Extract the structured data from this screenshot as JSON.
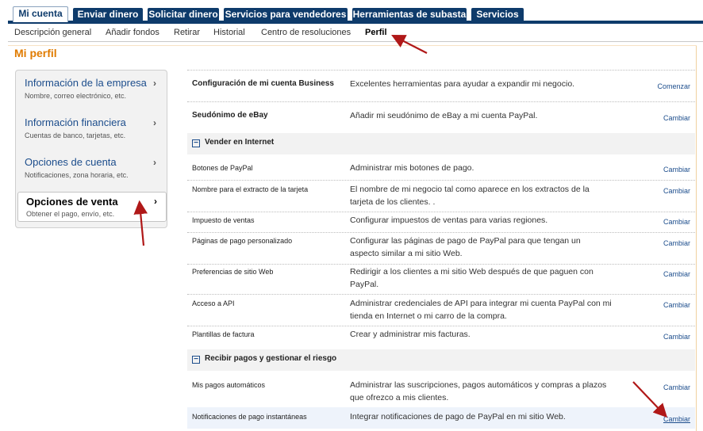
{
  "tabs": [
    {
      "label": "Mi cuenta",
      "active": true
    },
    {
      "label": "Enviar dinero"
    },
    {
      "label": "Solicitar dinero"
    },
    {
      "label": "Servicios para vendedores"
    },
    {
      "label": "Herramientas de subasta"
    },
    {
      "label": "Servicios"
    }
  ],
  "subnav": [
    {
      "label": "Descripción general"
    },
    {
      "label": "Añadir fondos"
    },
    {
      "label": "Retirar"
    },
    {
      "label": "Historial"
    },
    {
      "label": "Centro de resoluciones"
    },
    {
      "label": "Perfil",
      "active": true
    }
  ],
  "page_title": "Mi perfil",
  "sidebar": {
    "chevron": "›",
    "items": [
      {
        "title": "Información de la empresa",
        "subtitle": "Nombre, correo electrónico, etc."
      },
      {
        "title": "Información financiera",
        "subtitle": "Cuentas de banco, tarjetas, etc."
      },
      {
        "title": "Opciones de cuenta",
        "subtitle": "Notificaciones, zona horaria, etc."
      },
      {
        "title": "Opciones de venta",
        "subtitle": "Obtener el pago, envío, etc.",
        "active": true
      }
    ]
  },
  "rows_top": [
    {
      "name": "Configuración de mi cuenta Business",
      "desc": "Excelentes herramientas para ayudar a expandir mi negocio.",
      "action": "Comenzar"
    },
    {
      "name": "Seudónimo de eBay",
      "desc": "Añadir mi seudónimo de eBay a mi cuenta PayPal.",
      "action": "Cambiar"
    }
  ],
  "section_sell": {
    "label": "Vender en Internet",
    "rows": [
      {
        "name": "Botones de PayPal",
        "desc": "Administrar mis botones de pago.",
        "action": "Cambiar"
      },
      {
        "name": "Nombre para el extracto de la tarjeta",
        "desc": "El nombre de mi negocio tal como aparece en los extractos de la tarjeta de los clientes. .",
        "action": "Cambiar"
      },
      {
        "name": "Impuesto de ventas",
        "desc": "Configurar impuestos de ventas para varias regiones.",
        "action": "Cambiar"
      },
      {
        "name": "Páginas de pago personalizado",
        "desc": "Configurar las páginas de pago de PayPal para que tengan un aspecto similar a mi sitio Web.",
        "action": "Cambiar"
      },
      {
        "name": "Preferencias de sitio Web",
        "desc": "Redirigir a los clientes a mi sitio Web después de que paguen con PayPal.",
        "action": "Cambiar"
      },
      {
        "name": "Acceso a API",
        "desc": "Administrar credenciales de API para integrar mi cuenta PayPal con mi tienda en Internet o mi carro de la compra.",
        "action": "Cambiar"
      },
      {
        "name": "Plantillas de factura",
        "desc": "Crear y administrar mis facturas.",
        "action": "Cambiar"
      }
    ]
  },
  "section_receive": {
    "label": "Recibir pagos y gestionar el riesgo",
    "rows": [
      {
        "name": "Mis pagos automáticos",
        "desc": "Administrar las suscripciones, pagos automáticos y compras a plazos que ofrezco a mis clientes.",
        "action": "Cambiar"
      },
      {
        "name": "Notificaciones de pago instantáneas",
        "desc": "Integrar notificaciones de pago de PayPal en mi sitio Web.",
        "action": "Cambiar"
      }
    ]
  },
  "collapse_symbol": "−",
  "colors": {
    "nav": "#0e3b6b",
    "accent": "#e07b00",
    "link": "#1c4d8c",
    "arrow": "#b01818"
  }
}
